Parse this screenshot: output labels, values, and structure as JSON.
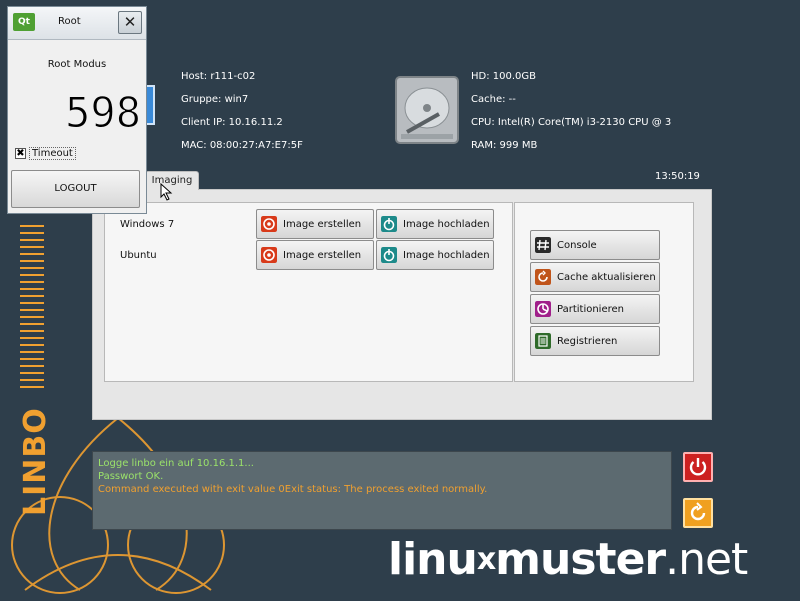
{
  "host_info": {
    "host": "Host: r111-c02",
    "group": "Gruppe: win7",
    "client_ip": "Client IP: 10.16.11.2",
    "mac": "MAC: 08:00:27:A7:E7:5F",
    "hd": "HD: 100.0GB",
    "cache": "Cache: --",
    "cpu": "CPU: Intel(R) Core(TM) i3-2130 CPU @ 3",
    "ram": "RAM: 999 MB"
  },
  "tabs": [
    {
      "label": "Imaging"
    }
  ],
  "clock": "13:50:19",
  "os_list": [
    {
      "name": "Windows 7",
      "create_label": "Image erstellen",
      "upload_label": "Image hochladen"
    },
    {
      "name": "Ubuntu",
      "create_label": "Image erstellen",
      "upload_label": "Image hochladen"
    }
  ],
  "actions": [
    {
      "label": "Console",
      "icon": "console-icon",
      "color": "#2a2a2a"
    },
    {
      "label": "Cache aktualisieren",
      "icon": "refresh-icon",
      "color": "#c0541a"
    },
    {
      "label": "Partitionieren",
      "icon": "partition-icon",
      "color": "#a0208a"
    },
    {
      "label": "Registrieren",
      "icon": "register-icon",
      "color": "#2f6b2a"
    }
  ],
  "log": {
    "lines": [
      {
        "text": "Logge linbo ein auf 10.16.1.1...",
        "color": "#9be36a"
      },
      {
        "text": "Passwort OK.",
        "color": "#9be36a"
      },
      {
        "text": "Command executed with exit value 0Exit status: The process exited normally.",
        "color": "#f0a030"
      }
    ]
  },
  "side_text": "LINBO",
  "brand": {
    "part1": "linu",
    "x": "x",
    "part2": "muster",
    "part3": ".net"
  },
  "dialog": {
    "title": "Root",
    "logo": "Qt",
    "close": "✕",
    "mode_label": "Root Modus",
    "countdown": "598",
    "timeout_label": "Timeout",
    "timeout_checked": "✖",
    "logout_label": "LOGOUT"
  },
  "colors": {
    "background": "#2e3e4b",
    "accent": "#f0a030",
    "log_green": "#9be36a",
    "create_icon": "#d83a1a",
    "upload_icon": "#1d8a8a",
    "shutdown": "#cc2020",
    "reboot": "#f0a020"
  }
}
